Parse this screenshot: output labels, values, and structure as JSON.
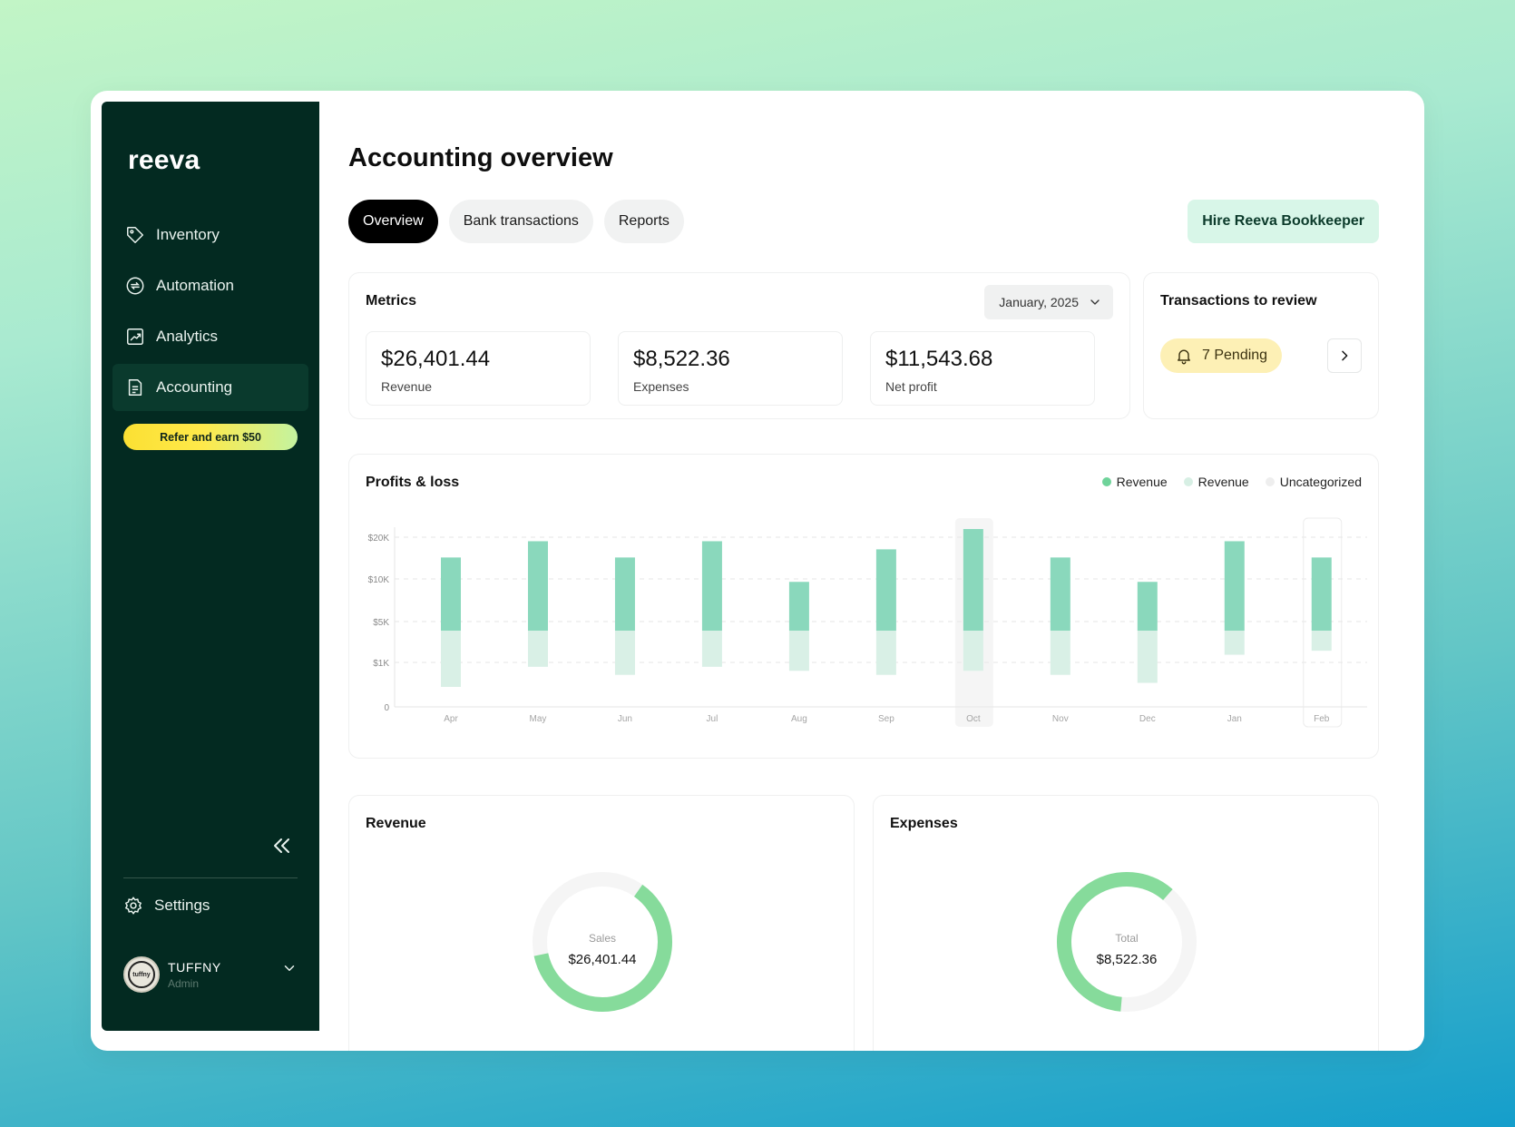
{
  "app": {
    "logo": "reeva"
  },
  "sidebar": {
    "items": [
      {
        "label": "Inventory",
        "icon": "tag-icon"
      },
      {
        "label": "Automation",
        "icon": "automation-icon"
      },
      {
        "label": "Analytics",
        "icon": "analytics-icon"
      },
      {
        "label": "Accounting",
        "icon": "document-icon",
        "active": true
      }
    ],
    "refer_label": "Refer and earn $50",
    "settings_label": "Settings",
    "user": {
      "name": "TUFFNY",
      "role": "Admin",
      "avatar_text": "tuffny"
    }
  },
  "page": {
    "title": "Accounting overview",
    "tabs": [
      {
        "label": "Overview",
        "active": true
      },
      {
        "label": "Bank transactions"
      },
      {
        "label": "Reports"
      }
    ],
    "hire_label": "Hire Reeva Bookkeeper"
  },
  "metrics": {
    "title": "Metrics",
    "date": "January, 2025",
    "items": [
      {
        "value": "$26,401.44",
        "label": "Revenue"
      },
      {
        "value": "$8,522.36",
        "label": "Expenses"
      },
      {
        "value": "$11,543.68",
        "label": "Net profit"
      }
    ]
  },
  "transactions": {
    "title": "Transactions to review",
    "pending_label": "7 Pending"
  },
  "profits": {
    "title": "Profits & loss",
    "legend": [
      {
        "label": "Revenue",
        "color": "#6fd39a"
      },
      {
        "label": "Revenue",
        "color": "#d7efe4"
      },
      {
        "label": "Uncategorized",
        "color": "#eeeeee"
      }
    ]
  },
  "chart_data": {
    "type": "bar",
    "categories": [
      "Apr",
      "May",
      "Jun",
      "Jul",
      "Aug",
      "Sep",
      "Oct",
      "Nov",
      "Dec",
      "Jan",
      "Feb"
    ],
    "y_ticks": [
      "$20K",
      "$10K",
      "$5K",
      "$1K",
      "0"
    ],
    "series": [
      {
        "name": "Revenue",
        "color": "#8ad8bc",
        "values": [
          9,
          11,
          9,
          11,
          6,
          10,
          12.5,
          9,
          6,
          11,
          9
        ]
      },
      {
        "name": "Revenue",
        "color": "#d9f0e6",
        "values": [
          0.7,
          0.45,
          0.55,
          0.45,
          0.5,
          0.55,
          0.5,
          0.55,
          0.65,
          0.3,
          0.25
        ]
      }
    ],
    "highlighted": [
      "Oct",
      "Feb"
    ],
    "grid": true
  },
  "revenue": {
    "title": "Revenue",
    "donut_label": "Sales",
    "donut_value": "$26,401.44",
    "fill_fraction": 0.62,
    "color": "#86db9b"
  },
  "expenses": {
    "title": "Expenses",
    "donut_label": "Total",
    "donut_value": "$8,522.36",
    "fill_fraction": 0.6,
    "color": "#86db9b"
  }
}
